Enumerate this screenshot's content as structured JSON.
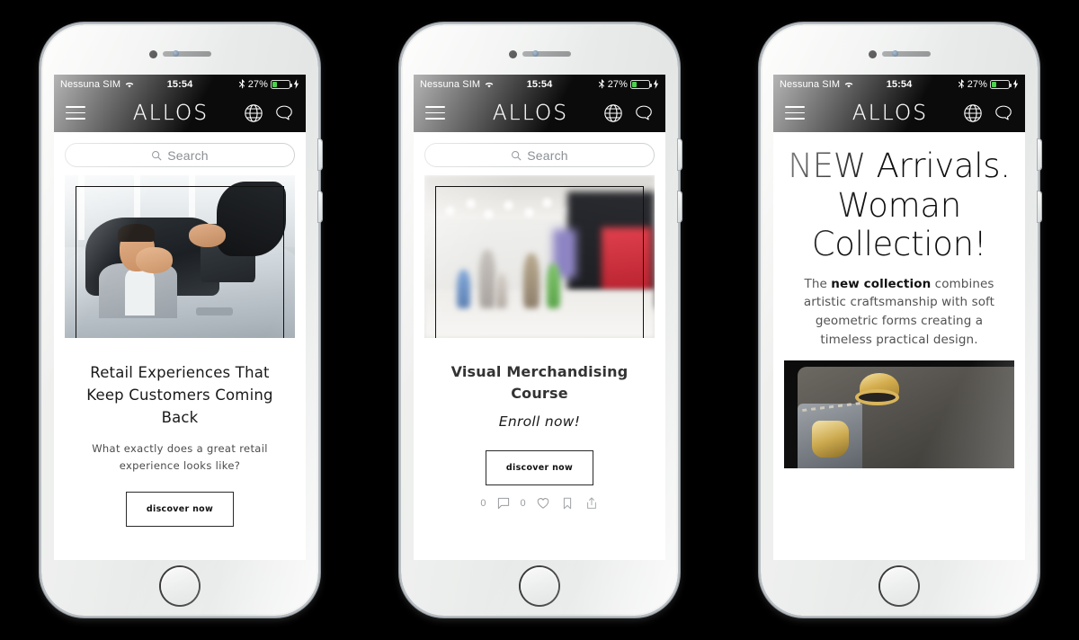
{
  "meta": {
    "background_color": "#000000",
    "accent_color": "#4cd24c",
    "app_bar_color": "#0b0b0b"
  },
  "status_bar": {
    "carrier": "Nessuna SIM",
    "wifi_icon": "wifi-icon",
    "time": "15:54",
    "bluetooth_icon": "bluetooth-icon",
    "battery_percent": "27%",
    "battery_fill_pct": 30,
    "charging_icon": "lightning-bolt-icon"
  },
  "app_bar": {
    "menu_icon": "hamburger-menu-icon",
    "brand": "ALLOS",
    "globe_icon": "globe-icon",
    "chat_icon": "chat-bubble-icon"
  },
  "search": {
    "icon": "search-icon",
    "placeholder": "Search"
  },
  "phones": [
    {
      "id": "phone-1",
      "screen_type": "article-card",
      "photo": "car-dealership-photo",
      "title": "Retail Experiences That Keep Customers Coming Back",
      "subtitle": "What exactly does a great retail experience looks like?",
      "cta": "discover now"
    },
    {
      "id": "phone-2",
      "screen_type": "course-card",
      "photo": "shopping-mall-photo",
      "title": "Visual Merchandising Course",
      "subtitle": "Enroll now!",
      "cta": "discover now",
      "social": {
        "comment_count": "0",
        "comment_icon": "comment-bubble-icon",
        "like_count": "0",
        "like_icon": "heart-icon",
        "bookmark_icon": "bookmark-icon",
        "share_icon": "share-icon"
      }
    },
    {
      "id": "phone-3",
      "screen_type": "collection-promo",
      "headline": "NEW Arrivals. Woman Collection!",
      "body_lead": "The ",
      "body_bold": "new collection",
      "body_rest": " combines artistic craftsmanship with soft geometric forms creating a timeless practical design.",
      "photo": "leather-handbag-photo"
    }
  ]
}
